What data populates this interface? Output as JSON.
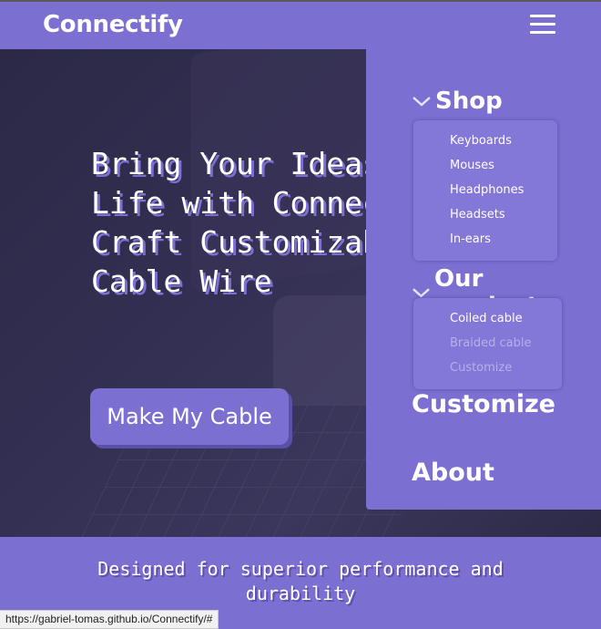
{
  "brand": "Connectify",
  "hero": {
    "title": "Bring Your Ideas to\nLife with Connectify:\nCraft Customizable\nCable Wire",
    "cta_label": "Make My Cable"
  },
  "menu": {
    "shop": {
      "label": "Shop",
      "items": [
        "Keyboards",
        "Mouses",
        "Headphones",
        "Headsets",
        "In-ears"
      ]
    },
    "products": {
      "label": "Our products",
      "items": [
        "Coiled cable",
        "Braided cable",
        "Customize"
      ]
    },
    "customize_label": "Customize",
    "about_label": "About"
  },
  "band_text": "Designed for superior performance and durability",
  "status_url": "https://gabriel-tomas.github.io/Connectify/#",
  "colors": {
    "accent": "#7b6fd2",
    "hero_bg": "#2f2b4a"
  }
}
